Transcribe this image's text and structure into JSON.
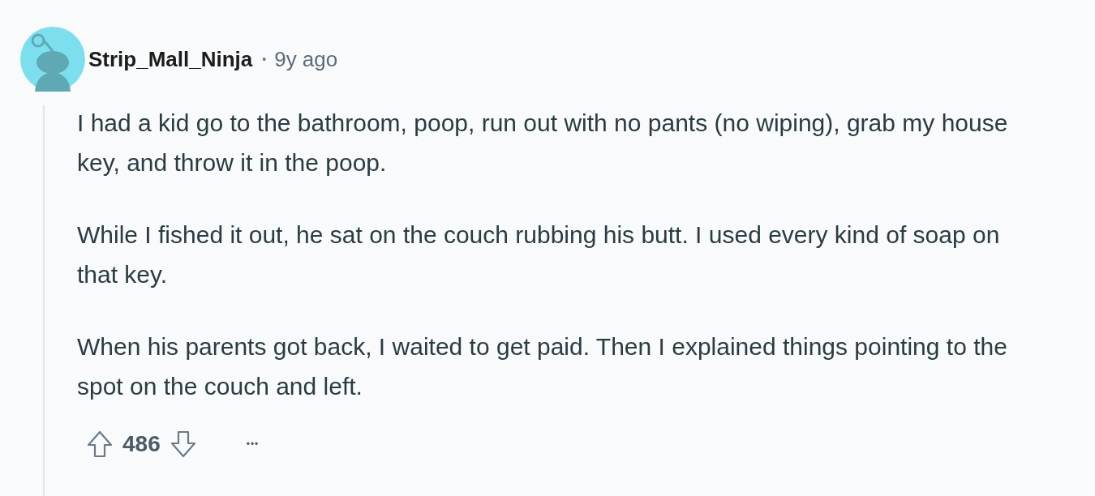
{
  "comment": {
    "author": "Strip_Mall_Ninja",
    "separator": "•",
    "age": "9y ago",
    "paragraphs": [
      "I had a kid go to the bathroom, poop, run out with no pants (no wiping), grab my house key, and throw it in the poop.",
      "While I fished it out, he sat on the couch rubbing his butt. I used every kind of soap on that key.",
      "When his parents got back, I waited to get paid. Then I explained things pointing to the spot on the couch and left."
    ],
    "score": "486",
    "more": "•••"
  }
}
